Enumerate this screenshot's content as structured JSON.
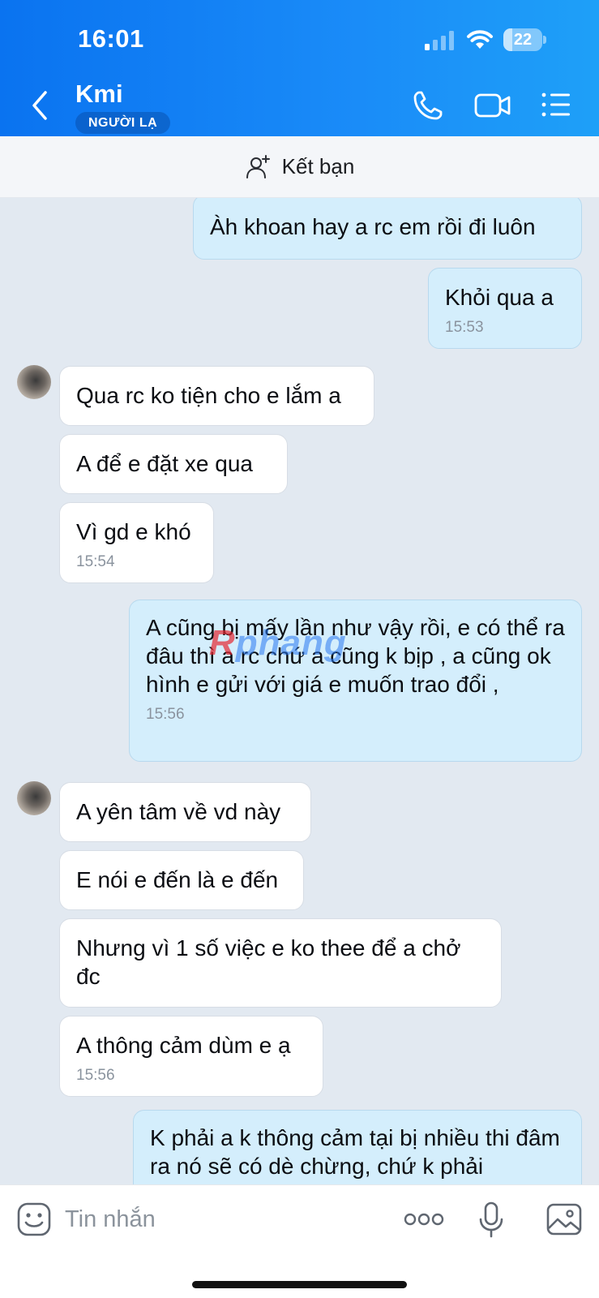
{
  "status_bar": {
    "time": "16:01",
    "battery_level": "22",
    "battery_fraction": 0.22
  },
  "header": {
    "contact_name": "Kmi",
    "badge": "NGƯỜI LẠ"
  },
  "friend_bar": {
    "label": "Kết bạn"
  },
  "messages": [
    {
      "dir": "out",
      "text": "Àh khoan hay a rc em rồi đi luôn",
      "time": ""
    },
    {
      "dir": "out",
      "text": "Khỏi qua a",
      "time": "15:53"
    },
    {
      "dir": "in",
      "text": "Qua rc ko tiện cho e lắm a",
      "time": ""
    },
    {
      "dir": "in",
      "text": "A để e đặt xe qua",
      "time": ""
    },
    {
      "dir": "in",
      "text": "Vì gd e khó",
      "time": "15:54"
    },
    {
      "dir": "out",
      "text": "A cũng bị mấy lần như vậy rồi, e có thể ra đâu thì a rc chứ a cũng k bịp , a cũng ok hình e gửi với giá e muốn trao đổi ,",
      "time": "15:56"
    },
    {
      "dir": "in",
      "text": "A yên tâm về vd này",
      "time": ""
    },
    {
      "dir": "in",
      "text": "E nói e đến là e đến",
      "time": ""
    },
    {
      "dir": "in",
      "text": "Nhưng vì 1 số việc e ko thee để a chở đc",
      "time": ""
    },
    {
      "dir": "in",
      "text": "A thông cảm dùm e ạ",
      "time": "15:56"
    },
    {
      "dir": "out",
      "text": "K phải a k thông cảm tại bị nhiều thi đâm ra nó sẽ có dè chừng, chứ k phải",
      "time": ""
    }
  ],
  "watermark": {
    "first": "R",
    "rest": "phang"
  },
  "input_bar": {
    "placeholder": "Tin nhắn"
  },
  "colors": {
    "header_start": "#0a73f0",
    "header_end": "#1ea0f8",
    "outgoing_bubble": "#d4eefc",
    "incoming_bubble": "#ffffff",
    "chat_background": "#e2e9f1"
  }
}
